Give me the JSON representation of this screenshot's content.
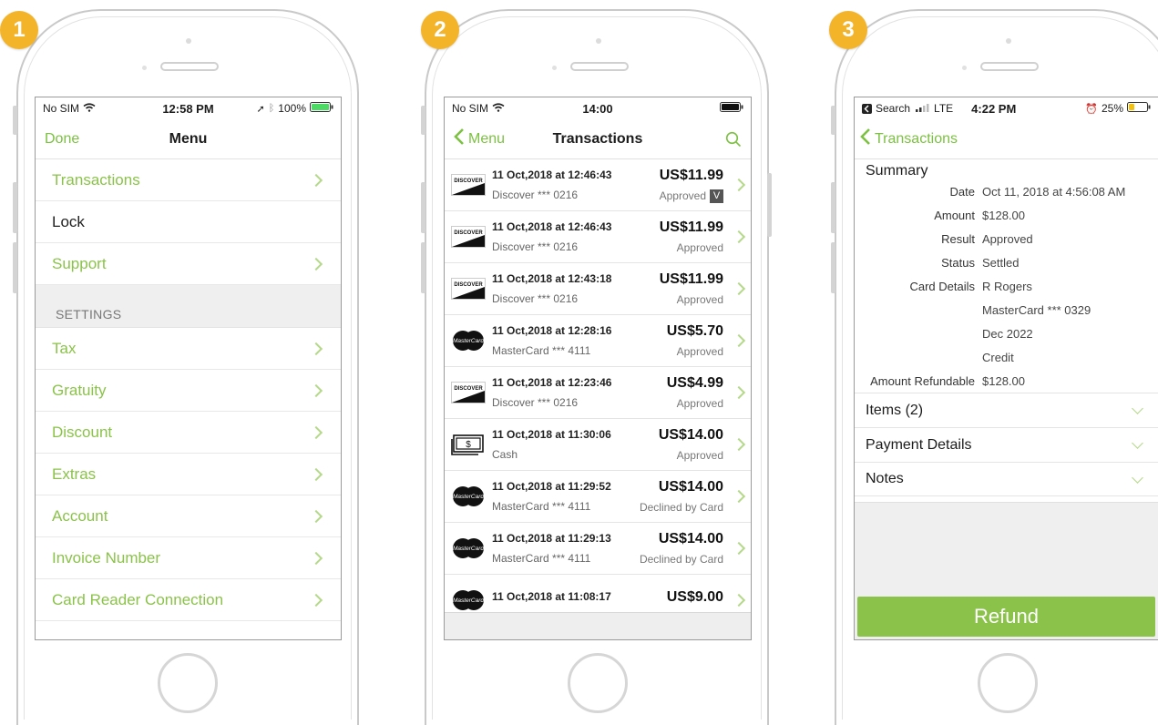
{
  "phones": [
    {
      "badge": "1",
      "status": {
        "carrier": "No SIM",
        "time": "12:58 PM",
        "battery": "100%"
      },
      "nav": {
        "done": "Done",
        "title": "Menu"
      },
      "rows_top": [
        "Transactions",
        "Lock",
        "Support"
      ],
      "settings_header": "SETTINGS",
      "rows_settings": [
        "Tax",
        "Gratuity",
        "Discount",
        "Extras",
        "Account",
        "Invoice Number",
        "Card Reader Connection"
      ]
    },
    {
      "badge": "2",
      "status": {
        "carrier": "No SIM",
        "time": "14:00"
      },
      "nav": {
        "back": "Menu",
        "title": "Transactions"
      },
      "transactions": [
        {
          "date": "11 Oct,2018 at 12:46:43",
          "card": "Discover *** 0216",
          "amount": "US$11.99",
          "status": "Approved",
          "badge": "V",
          "brand": "discover"
        },
        {
          "date": "11 Oct,2018 at 12:46:43",
          "card": "Discover *** 0216",
          "amount": "US$11.99",
          "status": "Approved",
          "badge": "",
          "brand": "discover"
        },
        {
          "date": "11 Oct,2018 at 12:43:18",
          "card": "Discover *** 0216",
          "amount": "US$11.99",
          "status": "Approved",
          "badge": "",
          "brand": "discover"
        },
        {
          "date": "11 Oct,2018 at 12:28:16",
          "card": "MasterCard *** 4111",
          "amount": "US$5.70",
          "status": "Approved",
          "badge": "",
          "brand": "mastercard"
        },
        {
          "date": "11 Oct,2018 at 12:23:46",
          "card": "Discover *** 0216",
          "amount": "US$4.99",
          "status": "Approved",
          "badge": "",
          "brand": "discover"
        },
        {
          "date": "11 Oct,2018 at 11:30:06",
          "card": "Cash",
          "amount": "US$14.00",
          "status": "Approved",
          "badge": "",
          "brand": "cash"
        },
        {
          "date": "11 Oct,2018 at 11:29:52",
          "card": "MasterCard *** 4111",
          "amount": "US$14.00",
          "status": "Declined by Card",
          "badge": "",
          "brand": "mastercard"
        },
        {
          "date": "11 Oct,2018 at 11:29:13",
          "card": "MasterCard *** 4111",
          "amount": "US$14.00",
          "status": "Declined by Card",
          "badge": "",
          "brand": "mastercard"
        },
        {
          "date": "11 Oct,2018 at 11:08:17",
          "card": "",
          "amount": "US$9.00",
          "status": "",
          "badge": "",
          "brand": "mastercard"
        }
      ],
      "logo_text": {
        "discover": "DISCOVER",
        "mastercard": "MasterCard",
        "cash": "$"
      }
    },
    {
      "badge": "3",
      "status": {
        "back_app": "Search",
        "network": "LTE",
        "time": "4:22 PM",
        "battery": "25%"
      },
      "nav": {
        "back": "Transactions"
      },
      "summary_title": "Summary",
      "details": [
        {
          "label": "Date",
          "value": "Oct 11, 2018 at 4:56:08 AM"
        },
        {
          "label": "Amount",
          "value": "$128.00"
        },
        {
          "label": "Result",
          "value": "Approved"
        },
        {
          "label": "Status",
          "value": "Settled"
        },
        {
          "label": "Card Details",
          "value": "R Rogers"
        },
        {
          "label": "",
          "value": "MasterCard *** 0329"
        },
        {
          "label": "",
          "value": "Dec 2022"
        },
        {
          "label": "",
          "value": "Credit"
        },
        {
          "label": "Amount Refundable",
          "value": "$128.00"
        }
      ],
      "sections": [
        "Items (2)",
        "Payment Details",
        "Notes"
      ],
      "refund_label": "Refund"
    }
  ],
  "colors": {
    "accent": "#8bc34a",
    "badge": "#f4b42a"
  }
}
